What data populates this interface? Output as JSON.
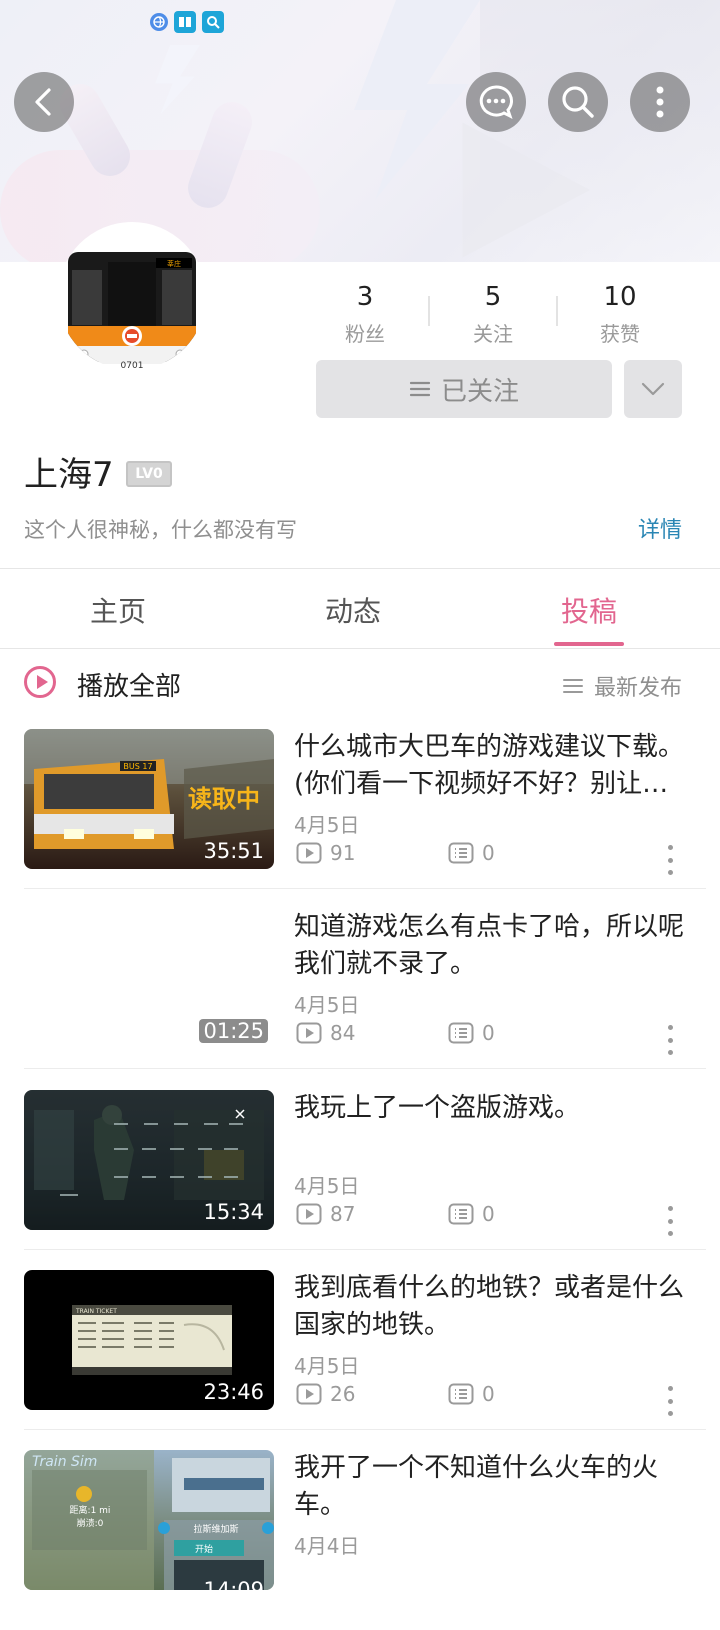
{
  "header": {
    "back_icon": "back-arrow-icon",
    "message_icon": "message-bubble-icon",
    "search_icon": "search-icon",
    "more_icon": "more-vertical-icon"
  },
  "profile": {
    "stats": [
      {
        "value": "3",
        "label": "粉丝"
      },
      {
        "value": "5",
        "label": "关注"
      },
      {
        "value": "10",
        "label": "获赞"
      }
    ],
    "follow_label": "已关注",
    "username": "上海7",
    "level": "LV0",
    "bio": "这个人很神秘，什么都没有写",
    "details_link": "详情",
    "avatar_plate": "0701",
    "avatar_sign": "莘庄"
  },
  "tabs": [
    {
      "label": "主页",
      "active": false
    },
    {
      "label": "动态",
      "active": false
    },
    {
      "label": "投稿",
      "active": true
    }
  ],
  "list_header": {
    "play_all": "播放全部",
    "sort": "最新发布"
  },
  "videos": [
    {
      "title": "什么城市大巴车的游戏建议下载。(你们看一下视频好不好？别让我白录了）",
      "date": "4月5日",
      "views": "91",
      "comments": "0",
      "duration": "35:51",
      "thumb_text": "读取中",
      "thumb_sign": "BUS 17"
    },
    {
      "title": "知道游戏怎么有点卡了哈，所以呢我们就不录了。",
      "date": "4月5日",
      "views": "84",
      "comments": "0",
      "duration": "01:25"
    },
    {
      "title": "我玩上了一个盗版游戏。",
      "date": "4月5日",
      "views": "87",
      "comments": "0",
      "duration": "15:34"
    },
    {
      "title": "我到底看什么的地铁？或者是什么国家的地铁。",
      "date": "4月5日",
      "views": "26",
      "comments": "0",
      "duration": "23:46",
      "thumb_text": "TRAIN TICKET"
    },
    {
      "title": "我开了一个不知道什么火车的火车。",
      "date": "4月4日",
      "views": "",
      "comments": "",
      "duration": "14:09",
      "thumb_text": "Train Sim",
      "thumb_sub1": "距离:1 mi",
      "thumb_sub2": "崩溃:0",
      "thumb_sub3": "拉斯维加斯",
      "thumb_sub4": "开始"
    }
  ],
  "colors": {
    "accent_pink": "#e2668f",
    "link_blue": "#2a86b4"
  }
}
